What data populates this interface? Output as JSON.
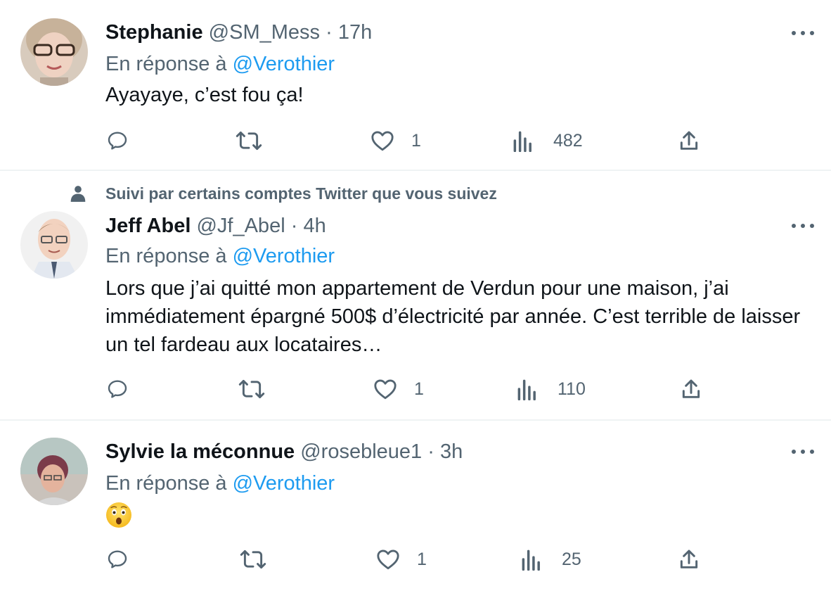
{
  "tweets": [
    {
      "name": "Stephanie",
      "handle": "@SM_Mess",
      "separator": "·",
      "time": "17h",
      "reply_prefix": "En réponse à",
      "reply_to": "@Verothier",
      "text": "Ayayaye, c’est fou ça!",
      "likes": "1",
      "views": "482"
    },
    {
      "social_context": "Suivi par certains comptes Twitter que vous suivez",
      "name": "Jeff Abel",
      "handle": "@Jf_Abel",
      "separator": "·",
      "time": "4h",
      "reply_prefix": "En réponse à",
      "reply_to": "@Verothier",
      "text": "Lors que j’ai quitté mon appartement de Verdun pour une maison, j’ai immédiatement épargné 500$ d’électricité par année. C’est terrible de laisser un tel fardeau aux locataires…",
      "likes": "1",
      "views": "110"
    },
    {
      "name": "Sylvie la méconnue",
      "handle": "@rosebleue1",
      "separator": "·",
      "time": "3h",
      "reply_prefix": "En réponse à",
      "reply_to": "@Verothier",
      "emoji": "astonished-face-emoji",
      "likes": "1",
      "views": "25"
    }
  ],
  "icons": {
    "reply": "reply-icon",
    "retweet": "retweet-icon",
    "like": "heart-icon",
    "views": "views-chart-icon",
    "share": "share-icon",
    "more": "more-options-icon",
    "person": "person-icon"
  },
  "colors": {
    "text_primary": "#0f1419",
    "text_secondary": "#536471",
    "accent": "#1d9bf0",
    "divider": "#eff3f4"
  }
}
